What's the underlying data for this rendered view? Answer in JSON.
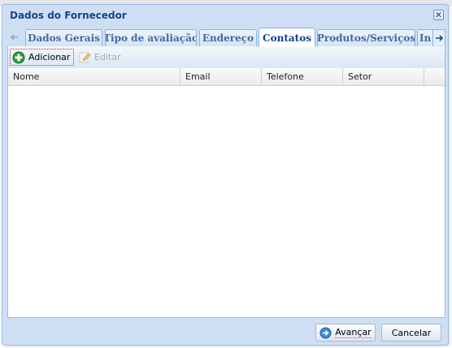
{
  "window": {
    "title": "Dados do Fornecedor",
    "close_icon": "close-icon"
  },
  "tabs": [
    {
      "label": "Dados Gerais",
      "active": false
    },
    {
      "label": "Tipo de avaliação",
      "active": false
    },
    {
      "label": "Endereço",
      "active": false
    },
    {
      "label": "Contatos",
      "active": true
    },
    {
      "label": "Produtos/Serviços",
      "active": false
    },
    {
      "label": "In",
      "active": false
    }
  ],
  "toolbar": {
    "add_label": "Adicionar",
    "edit_label": "Editar",
    "edit_disabled": true
  },
  "grid": {
    "columns": [
      "Nome",
      "Email",
      "Telefone",
      "Setor"
    ],
    "rows": []
  },
  "footer": {
    "next_label": "Avançar",
    "cancel_label": "Cancelar"
  },
  "colors": {
    "title": "#15428b",
    "border": "#99bbe8",
    "add_icon": "#2e9a2e"
  }
}
